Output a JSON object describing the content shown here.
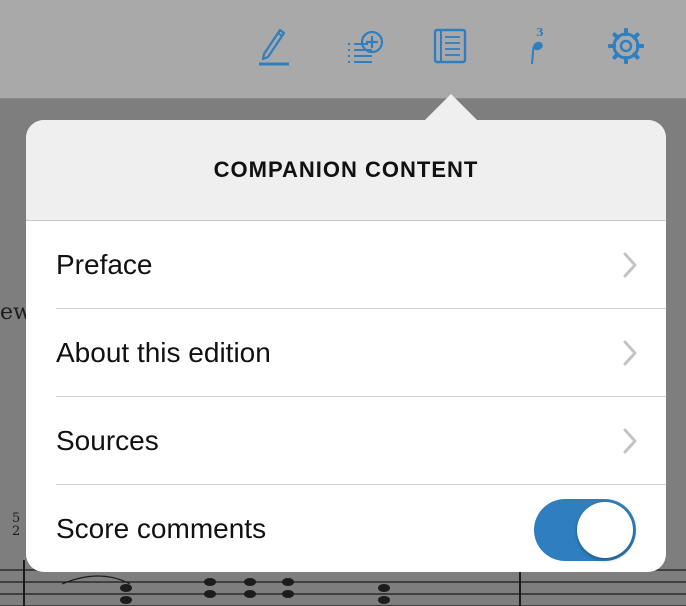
{
  "toolbar": {
    "icons": [
      "pencil-icon",
      "add-list-icon",
      "book-icon",
      "fingering-icon",
      "gear-icon"
    ],
    "fingering_number": "3",
    "accent_color": "#2f7fc0"
  },
  "background_page": {
    "word_fragment": "ew",
    "fingering_top": "5",
    "fingering_bottom": "2"
  },
  "popover": {
    "title": "COMPANION CONTENT",
    "items": [
      {
        "label": "Preface",
        "type": "disclosure"
      },
      {
        "label": "About this edition",
        "type": "disclosure"
      },
      {
        "label": "Sources",
        "type": "disclosure"
      },
      {
        "label": "Score comments",
        "type": "toggle",
        "value": true
      }
    ]
  }
}
